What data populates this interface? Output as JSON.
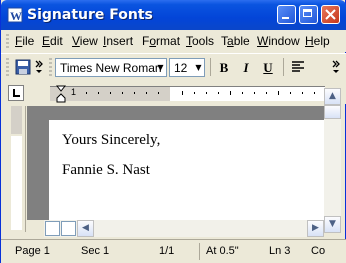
{
  "window": {
    "title": "Signature Fonts"
  },
  "menu": [
    {
      "id": "file",
      "pre": "",
      "u": "F",
      "post": "ile"
    },
    {
      "id": "edit",
      "pre": "",
      "u": "E",
      "post": "dit"
    },
    {
      "id": "view",
      "pre": "",
      "u": "V",
      "post": "iew"
    },
    {
      "id": "insert",
      "pre": "",
      "u": "I",
      "post": "nsert"
    },
    {
      "id": "format",
      "pre": "F",
      "u": "o",
      "post": "rmat"
    },
    {
      "id": "tools",
      "pre": "",
      "u": "T",
      "post": "ools"
    },
    {
      "id": "table",
      "pre": "T",
      "u": "a",
      "post": "ble"
    },
    {
      "id": "window",
      "pre": "",
      "u": "W",
      "post": "indow"
    },
    {
      "id": "help",
      "pre": "",
      "u": "H",
      "post": "elp"
    }
  ],
  "toolbar": {
    "font_name": "Times New Roman",
    "font_size": "12",
    "bold": "B",
    "italic": "I",
    "underline": "U"
  },
  "ruler": {
    "mark": "1"
  },
  "document": {
    "lines": [
      "Yours Sincerely,",
      "Fannie S. Nast"
    ]
  },
  "status": {
    "page": "Page  1",
    "sec": "Sec  1",
    "pages": "1/1",
    "at": "At  0.5\"",
    "ln": "Ln  3",
    "col": "Co"
  },
  "colors": {
    "titlebar": "#0a54e0",
    "chrome": "#ece9d8"
  }
}
